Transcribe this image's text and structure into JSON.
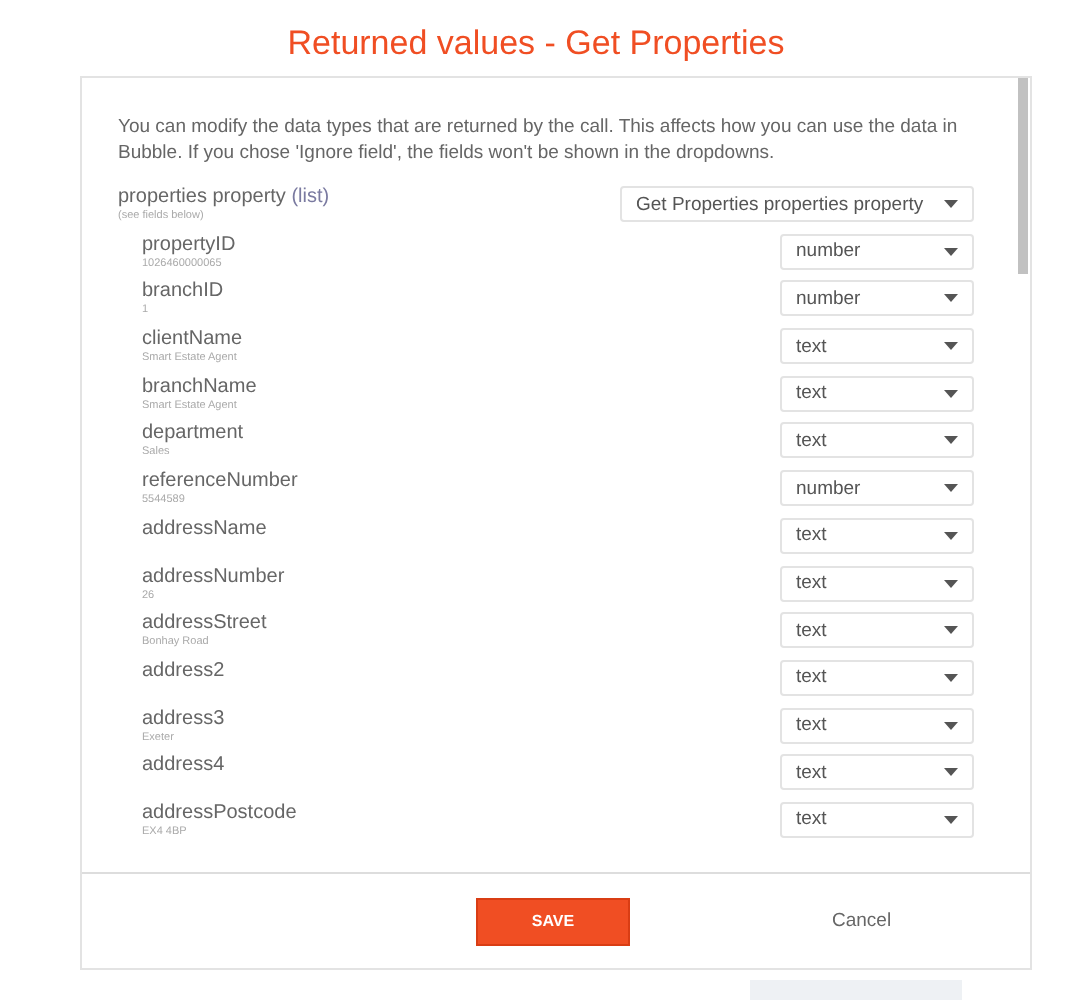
{
  "title": "Returned values - Get Properties",
  "intro": "You can modify the data types that are returned by the call. This affects how you can use the data in Bubble. If you chose 'Ignore field', the fields won't be shown in the dropdowns.",
  "parent": {
    "name": "properties property",
    "suffix": "(list)",
    "hint": "(see fields below)",
    "type": "Get Properties properties property"
  },
  "fields": [
    {
      "name": "propertyID",
      "sample": "1026460000065",
      "type": "number"
    },
    {
      "name": "branchID",
      "sample": "1",
      "type": "number"
    },
    {
      "name": "clientName",
      "sample": "Smart Estate Agent",
      "type": "text"
    },
    {
      "name": "branchName",
      "sample": "Smart Estate Agent",
      "type": "text"
    },
    {
      "name": "department",
      "sample": "Sales",
      "type": "text"
    },
    {
      "name": "referenceNumber",
      "sample": "5544589",
      "type": "number"
    },
    {
      "name": "addressName",
      "type": "text"
    },
    {
      "name": "addressNumber",
      "sample": "26",
      "type": "text"
    },
    {
      "name": "addressStreet",
      "sample": "Bonhay Road",
      "type": "text"
    },
    {
      "name": "address2",
      "type": "text"
    },
    {
      "name": "address3",
      "sample": "Exeter",
      "type": "text"
    },
    {
      "name": "address4",
      "type": "text"
    },
    {
      "name": "addressPostcode",
      "sample": "EX4 4BP",
      "type": "text"
    }
  ],
  "buttons": {
    "save": "SAVE",
    "cancel": "Cancel"
  }
}
